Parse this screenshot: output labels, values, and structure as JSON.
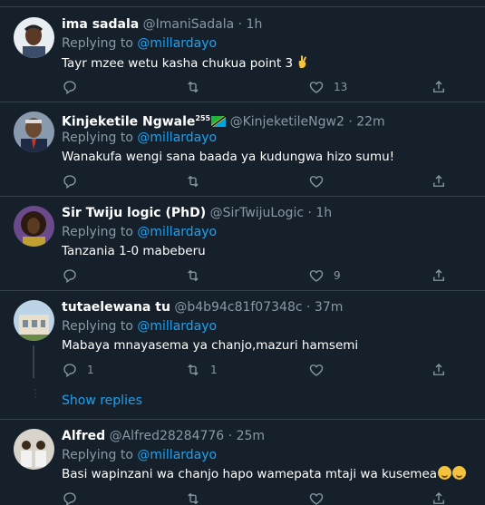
{
  "colors": {
    "background": "#15202b",
    "border": "#38444d",
    "muted": "#8899a6",
    "link": "#1da1f2"
  },
  "tweets": [
    {
      "name": "ima sadala",
      "handle": "@ImaniSadala",
      "dot": "·",
      "time": "1h",
      "replying_prefix": "Replying to ",
      "replying_to": "@millardayo",
      "text": "Tayr mzee wetu kasha chukua point 3",
      "text_emoji": "crossed-fingers",
      "reply_count": "",
      "retweet_count": "",
      "like_count": "13"
    },
    {
      "name": "Kinjeketile Ngwale",
      "name_sup": "255",
      "name_flag": "tanzania-flag",
      "handle": "@KinjeketileNgw2",
      "dot": "·",
      "time": "22m",
      "replying_prefix": "Replying to ",
      "replying_to": "@millardayo",
      "text": "Wanakufa wengi sana baada ya kudungwa hizo sumu!",
      "reply_count": "",
      "retweet_count": "",
      "like_count": ""
    },
    {
      "name": "Sir Twiju logic (PhD)",
      "handle": "@SirTwijuLogic",
      "dot": "·",
      "time": "1h",
      "replying_prefix": "Replying to ",
      "replying_to": "@millardayo",
      "text": "Tanzania 1-0 mabeberu",
      "reply_count": "",
      "retweet_count": "",
      "like_count": "9"
    },
    {
      "name": "tutaelewana tu",
      "handle": "@b4b94c81f07348c",
      "dot": "·",
      "time": "37m",
      "replying_prefix": "Replying to ",
      "replying_to": "@millardayo",
      "text": "Mabaya mnayasema ya chanjo,mazuri hamsemi",
      "reply_count": "1",
      "retweet_count": "1",
      "like_count": ""
    },
    {
      "name": "Alfred",
      "handle": "@Alfred28284776",
      "dot": "·",
      "time": "25m",
      "replying_prefix": "Replying to ",
      "replying_to": "@millardayo",
      "text": "Basi wapinzani wa chanjo hapo wamepata mtaji wa kusemea",
      "text_emoji": "rolling-on-floor-laughing x2"
    }
  ],
  "show_replies": "Show replies"
}
